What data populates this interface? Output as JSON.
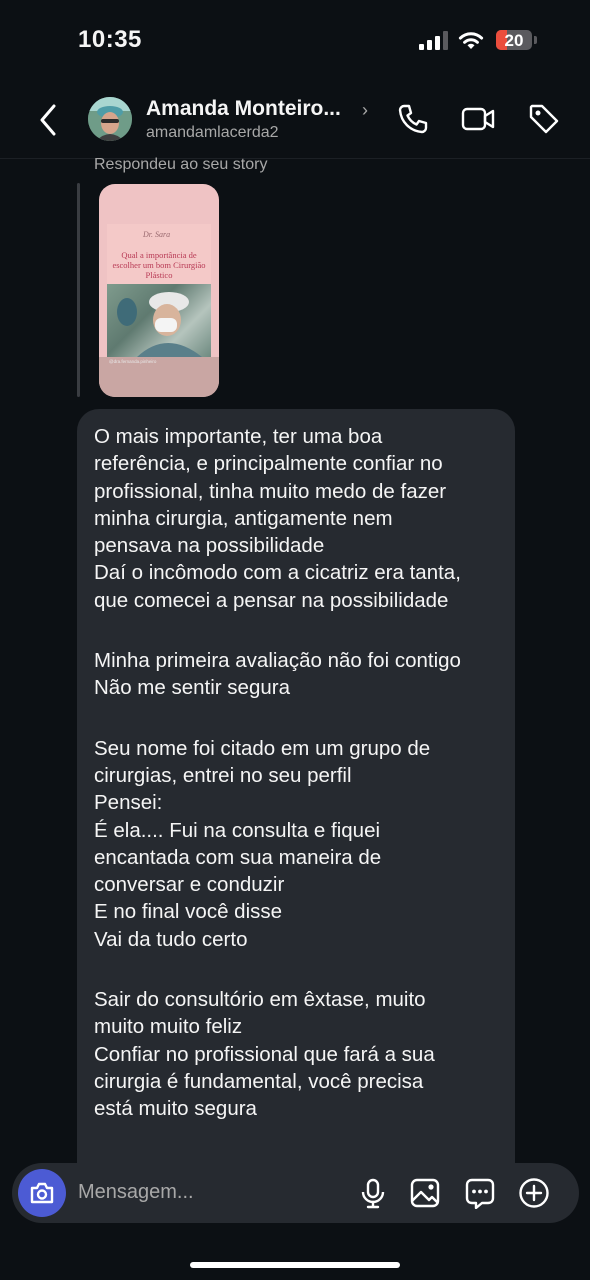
{
  "status_bar": {
    "time": "10:35",
    "battery": "20"
  },
  "header": {
    "name": "Amanda Monteiro...",
    "username": "amandamlacerda2"
  },
  "story_reply": {
    "label": "Respondeu ao seu story",
    "story_title": "Qual a importância de escolher um bom Cirurgião Plástico",
    "story_logo": "Dr. Sara",
    "story_caption": "@dra.fernanda.pinheiro"
  },
  "message": {
    "paragraphs": [
      [
        "O mais importante, ter uma boa",
        "referência, e principalmente confiar no",
        "profissional, tinha muito medo de fazer",
        "minha cirurgia, antigamente nem",
        "pensava na possibilidade",
        "Daí o incômodo com a cicatriz era tanta,",
        "que comecei a pensar na possibilidade"
      ],
      [
        "Minha primeira avaliação não foi contigo",
        "Não me sentir segura"
      ],
      [
        "Seu nome foi citado em um grupo de",
        "cirurgias, entrei no seu perfil",
        "Pensei:",
        "É ela.... Fui na consulta e fiquei",
        "encantada com sua maneira de",
        "conversar e conduzir",
        "E no final você disse",
        "Vai da tudo certo"
      ],
      [
        "Sair do consultório em êxtase, muito",
        "muito muito feliz",
        "Confiar no profissional que fará a sua",
        "cirurgia é fundamental, você precisa",
        "está muito segura"
      ]
    ]
  },
  "composer": {
    "placeholder": "Mensagem..."
  },
  "colors": {
    "camera_button": "#4c5bd4",
    "bubble": "#262a30",
    "background": "#0c1014",
    "battery_low": "#eb4d3d"
  }
}
